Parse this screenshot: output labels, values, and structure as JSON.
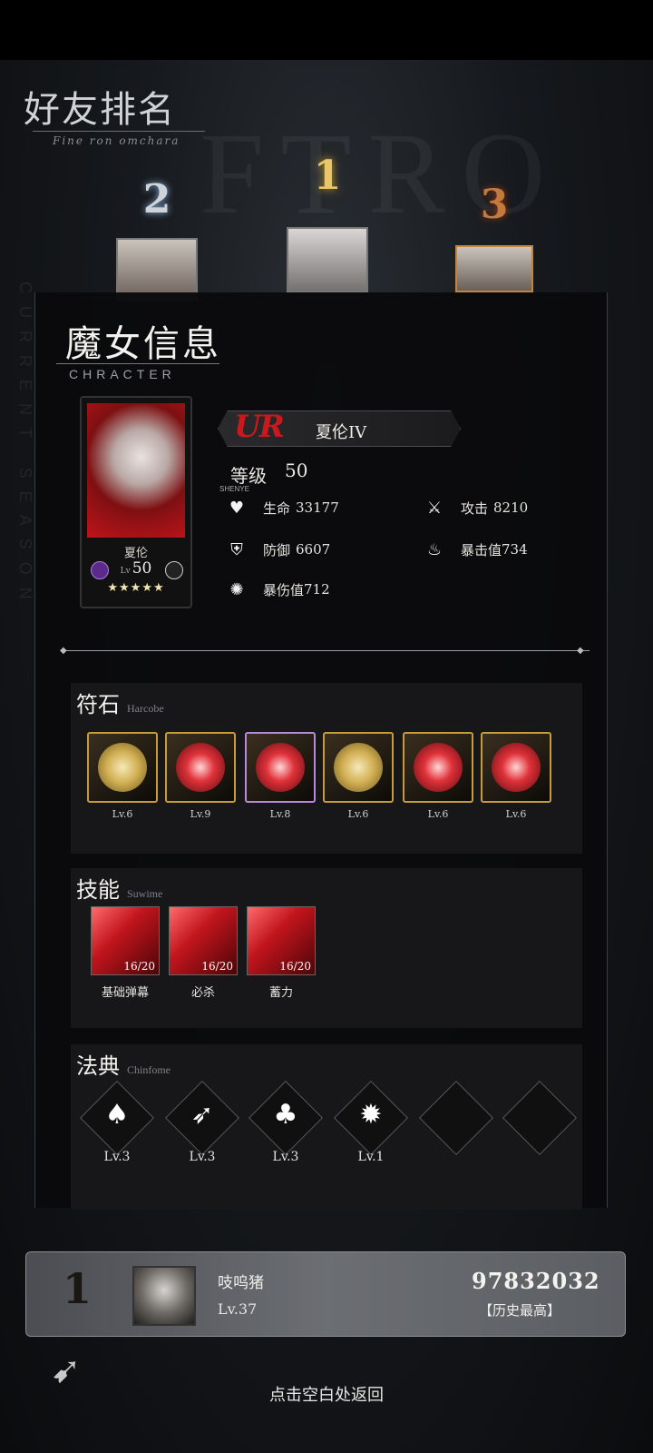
{
  "page": {
    "title": "好友排名",
    "subtitle": "Fine ron omchara",
    "watermark": "FTRO",
    "vertical_watermark": "CURRENT SEASON"
  },
  "podium": [
    {
      "rank": "2"
    },
    {
      "rank": "1"
    },
    {
      "rank": "3"
    }
  ],
  "modal": {
    "title": "魔女信息",
    "subtitle": "CHRACTER",
    "card": {
      "name": "夏伦",
      "lv_prefix": "Lv",
      "level": "50",
      "stars": "★★★★★"
    },
    "rarity": "UR",
    "char_name": "夏伦IV",
    "level_label": "等级",
    "level_value": "50",
    "level_tag": "SHENYE",
    "stats": [
      {
        "icon": "heart-icon",
        "label": "生命",
        "value": "33177"
      },
      {
        "icon": "sword-icon",
        "label": "攻击",
        "value": "8210"
      },
      {
        "icon": "shield-icon",
        "label": "防御",
        "value": "6607"
      },
      {
        "icon": "flame-icon",
        "label": "暴击值",
        "value": "734"
      },
      {
        "icon": "burst-icon",
        "label": "暴伤值",
        "value": "712"
      }
    ]
  },
  "runes": {
    "title": "符石",
    "subtitle": "Harcobe",
    "items": [
      {
        "level": "Lv.6",
        "style": "gold"
      },
      {
        "level": "Lv.9",
        "style": "red"
      },
      {
        "level": "Lv.8",
        "style": "red"
      },
      {
        "level": "Lv.6",
        "style": "gold"
      },
      {
        "level": "Lv.6",
        "style": "red"
      },
      {
        "level": "Lv.6",
        "style": "red"
      }
    ]
  },
  "skills": {
    "title": "技能",
    "subtitle": "Suwime",
    "items": [
      {
        "name": "基础弹幕",
        "count": "16/20"
      },
      {
        "name": "必杀",
        "count": "16/20"
      },
      {
        "name": "蓄力",
        "count": "16/20"
      }
    ]
  },
  "codex": {
    "title": "法典",
    "subtitle": "Chinfome",
    "items": [
      {
        "level": "Lv.3",
        "glyph": "♠"
      },
      {
        "level": "Lv.3",
        "glyph": "➶"
      },
      {
        "level": "Lv.3",
        "glyph": "♣"
      },
      {
        "level": "Lv.1",
        "glyph": "✹"
      },
      {
        "level": "",
        "glyph": ""
      },
      {
        "level": "",
        "glyph": ""
      }
    ]
  },
  "bottom": {
    "rank": "1",
    "name": "吱呜猪",
    "level": "Lv.37",
    "score": "97832032",
    "note": "【历史最高】"
  },
  "hint": "点击空白处返回"
}
